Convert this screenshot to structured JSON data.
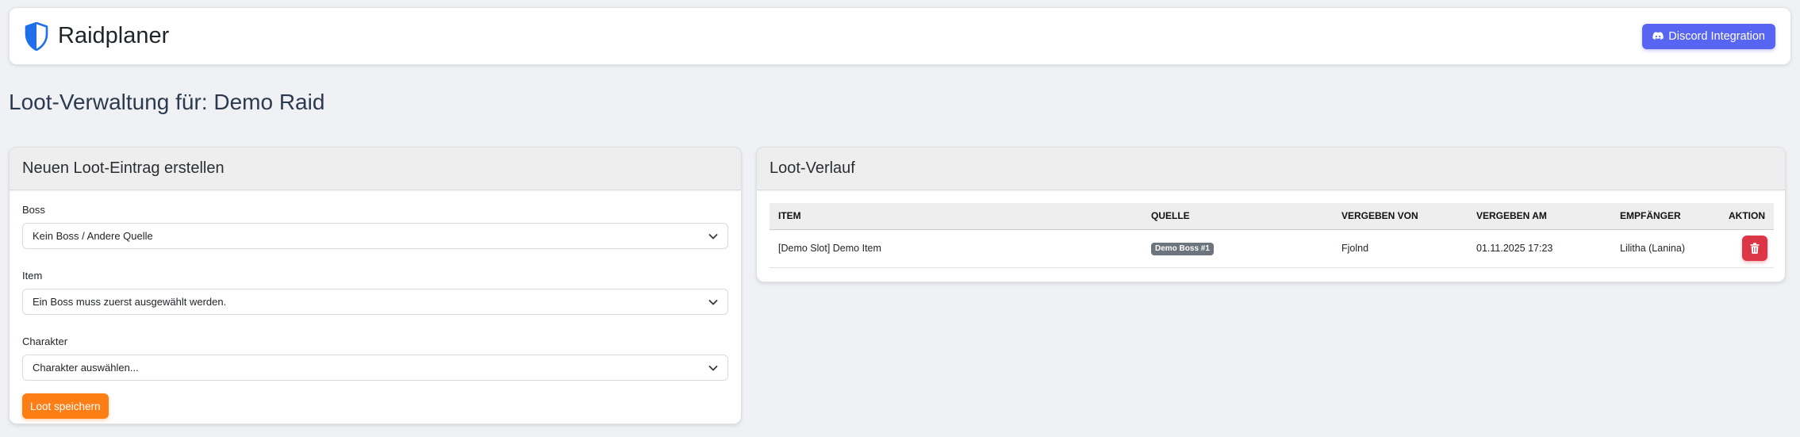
{
  "app": {
    "brand_name": "Raidplaner",
    "brand_icon": "shield-icon",
    "accent_color": "#1f6feb"
  },
  "navbar": {
    "discord_button_label": "Discord Integration",
    "discord_icon": "discord-icon",
    "discord_color": "#5865f2"
  },
  "page": {
    "title": "Loot-Verwaltung für: Demo Raid"
  },
  "form_card": {
    "header": "Neuen Loot-Eintrag erstellen",
    "boss": {
      "label": "Boss",
      "selected": "Kein Boss / Andere Quelle"
    },
    "item": {
      "label": "Item",
      "selected": "Ein Boss muss zuerst ausgewählt werden."
    },
    "character": {
      "label": "Charakter",
      "selected": "Charakter auswählen..."
    },
    "save_label": "Loot speichern",
    "save_color": "#fd7e14"
  },
  "history_card": {
    "header": "Loot-Verlauf",
    "columns": [
      "Item",
      "Quelle",
      "Vergeben von",
      "Vergeben am",
      "Empfänger",
      "Aktion"
    ],
    "rows": [
      {
        "item": "[Demo Slot] Demo Item",
        "source": "Demo Boss #1",
        "given_by": "Fjolnd",
        "given_at": "01.11.2025 17:23",
        "recipient": "Lilitha (Lanina)",
        "action_icon": "trash-icon",
        "action_color": "#dc3545"
      }
    ]
  }
}
